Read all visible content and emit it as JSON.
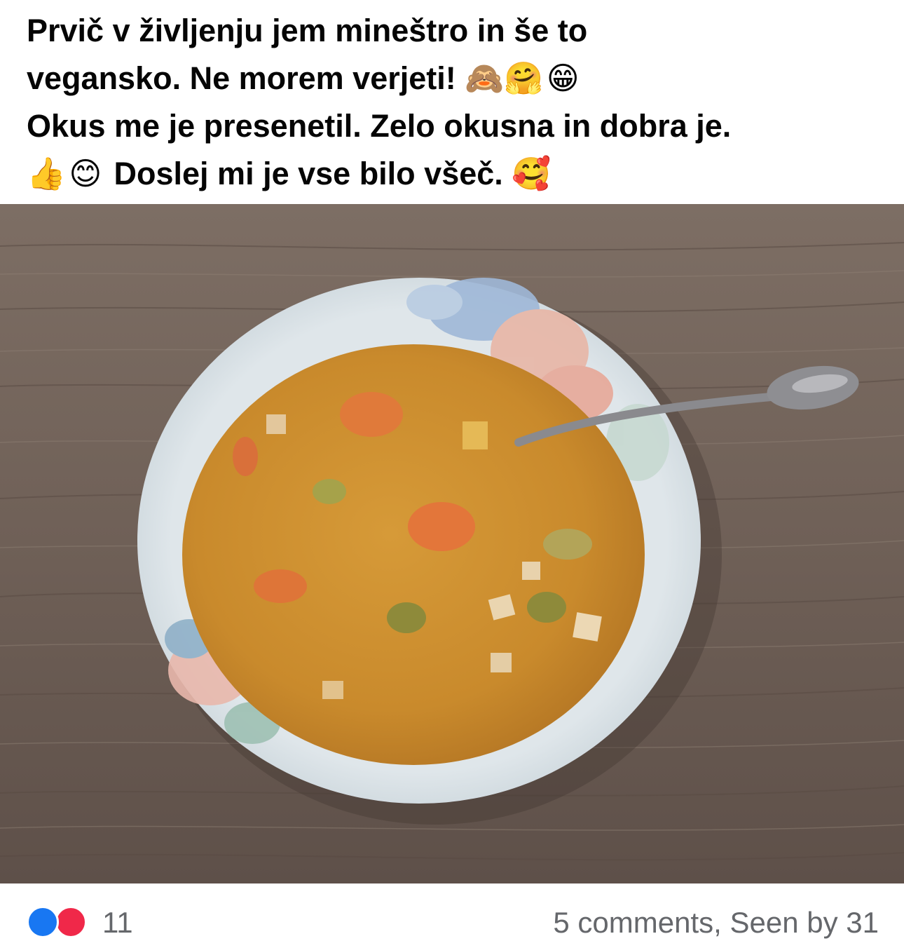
{
  "post": {
    "text_line1": "Prvič v življenju jem mineštro in še to",
    "text_line2": "vegansko. Ne morem verjeti!",
    "text_line3": "Okus me je presenetil. Zelo okusna in dobra je.",
    "text_line4": "Doslej mi je vse bilo všeč.",
    "emoji_see_no_evil": "🙈",
    "emoji_hug": "🤗",
    "emoji_grin": "😁",
    "emoji_thumbs_up": "👍",
    "emoji_smile": "😊",
    "emoji_hearts": "🥰"
  },
  "footer": {
    "reaction_icons": [
      "like-icon",
      "love-icon"
    ],
    "reaction_count": "11",
    "comments_label": "5 comments",
    "seen_label": "Seen by 31"
  },
  "colors": {
    "text": "#050505",
    "secondary": "#65676b",
    "like": "#1877f2",
    "love": "#f02849"
  }
}
